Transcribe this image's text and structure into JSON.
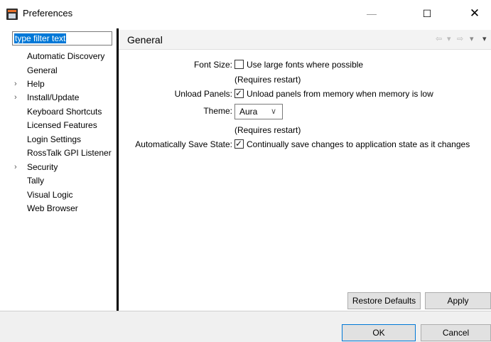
{
  "window": {
    "title": "Preferences",
    "minimize_glyph": "—",
    "maximize_glyph": "☐",
    "close_glyph": "✕"
  },
  "filter": {
    "placeholder": "type filter text"
  },
  "tree": {
    "items": [
      {
        "label": "Automatic Discovery",
        "expandable": false
      },
      {
        "label": "General",
        "expandable": false
      },
      {
        "label": "Help",
        "expandable": true
      },
      {
        "label": "Install/Update",
        "expandable": true
      },
      {
        "label": "Keyboard Shortcuts",
        "expandable": false
      },
      {
        "label": "Licensed Features",
        "expandable": false
      },
      {
        "label": "Login Settings",
        "expandable": false
      },
      {
        "label": "RossTalk GPI Listener",
        "expandable": false
      },
      {
        "label": "Security",
        "expandable": true
      },
      {
        "label": "Tally",
        "expandable": false
      },
      {
        "label": "Visual Logic",
        "expandable": false
      },
      {
        "label": "Web Browser",
        "expandable": false
      }
    ],
    "expand_glyph": "›"
  },
  "page": {
    "title": "General",
    "nav": {
      "back": "⇦",
      "back_menu": "▾",
      "forward": "⇨",
      "forward_menu": "▾",
      "view_menu": "▾"
    }
  },
  "form": {
    "font_size": {
      "label": "Font Size:",
      "checkbox_text": "Use large fonts where possible",
      "checked": false,
      "note": "(Requires restart)"
    },
    "unload_panels": {
      "label": "Unload Panels:",
      "checkbox_text": "Unload panels from memory when memory is low",
      "checked": true
    },
    "theme": {
      "label": "Theme:",
      "value": "Aura",
      "note": "(Requires restart)"
    },
    "auto_save": {
      "label": "Automatically Save State:",
      "checkbox_text": "Continually save changes to application state as it changes",
      "checked": true
    },
    "check_glyph": "✓",
    "dropdown_glyph": "∨"
  },
  "buttons": {
    "restore_defaults": "Restore Defaults",
    "apply": "Apply",
    "ok": "OK",
    "cancel": "Cancel"
  }
}
